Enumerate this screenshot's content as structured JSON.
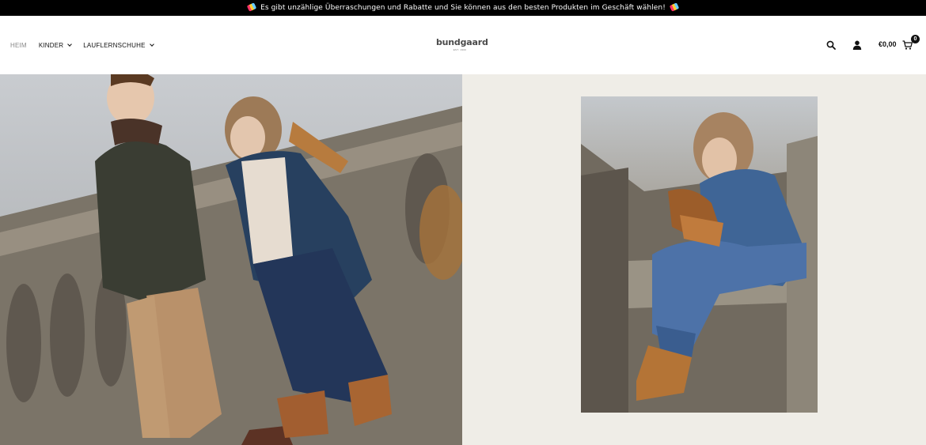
{
  "announcement": {
    "text": "Es gibt unzählige Überraschungen und Rabatte und Sie können aus den besten Produkten im Geschäft wählen!"
  },
  "nav": {
    "items": [
      {
        "label": "HEIM",
        "active": true,
        "has_dropdown": false
      },
      {
        "label": "KINDER",
        "active": false,
        "has_dropdown": true
      },
      {
        "label": "LAUFLERNSCHUHE",
        "active": false,
        "has_dropdown": true
      }
    ]
  },
  "brand": {
    "logo_text": "bundgaard",
    "logo_subtext": "EST. 1900"
  },
  "cart": {
    "total": "€0,00",
    "count": "0"
  },
  "colors": {
    "announcement_bg": "#000000",
    "right_panel_bg": "#efede7",
    "nav_active": "#888888"
  },
  "icons": {
    "search": "search-icon",
    "account": "user-icon",
    "cart": "cart-icon"
  }
}
